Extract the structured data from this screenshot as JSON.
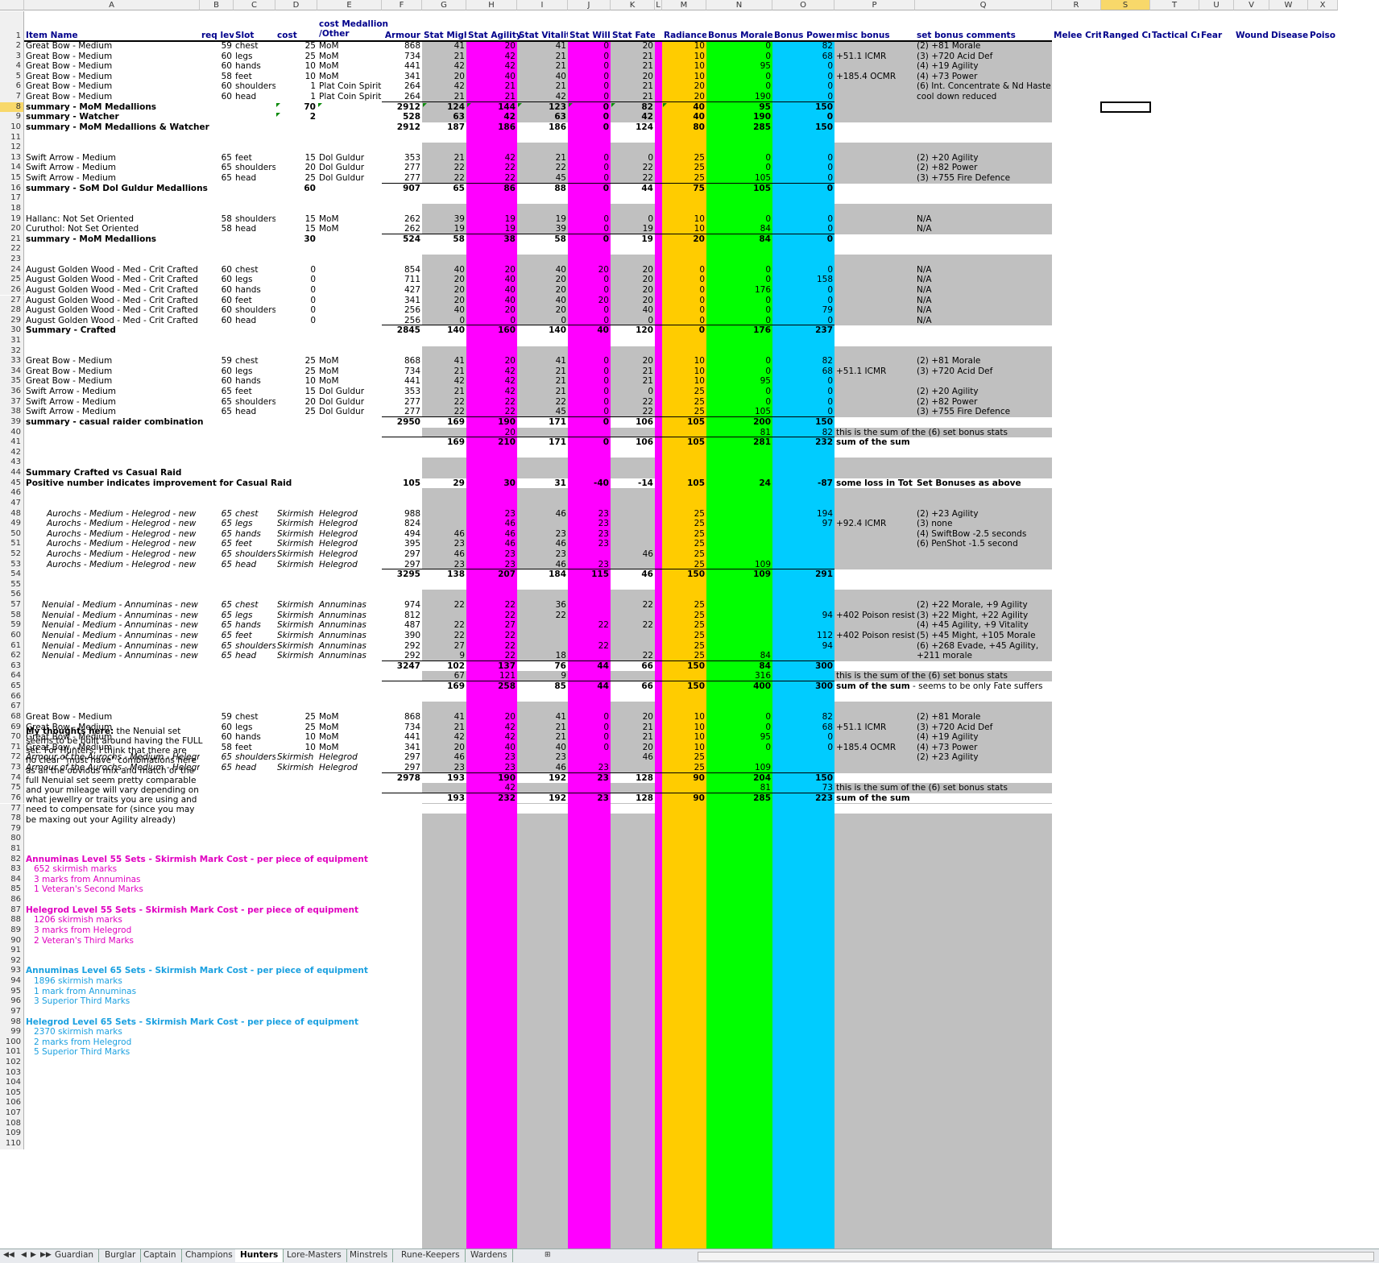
{
  "columns": [
    "A",
    "B",
    "C",
    "D",
    "E",
    "F",
    "G",
    "H",
    "I",
    "J",
    "K",
    "L",
    "M",
    "N",
    "O",
    "P",
    "Q",
    "R",
    "S",
    "T",
    "U",
    "V",
    "W",
    "X"
  ],
  "tabs": [
    "Guardian",
    "Burglar",
    "Captain",
    "Champions",
    "Hunters",
    "Lore-Masters",
    "Minstrels",
    "Rune-Keepers",
    "Wardens"
  ],
  "active_tab": "Hunters",
  "colors": {
    "grey": "#c0c0c0",
    "magenta": "#ff00ff",
    "orange": "#ffcc00",
    "green": "#00ff00",
    "cyan": "#00ccff",
    "header_text": "#00008b"
  },
  "header": {
    "A": "Item Name",
    "B": "req level",
    "C": "Slot",
    "D": "cost",
    "E1": "cost Medallion",
    "E2": "/Other",
    "F": "Armour",
    "G": "Stat Might",
    "H": "Stat Agility",
    "I": "Stat Vitality",
    "J": "Stat Will",
    "K": "Stat Fate",
    "M": "Radiance",
    "N": "Bonus Morale",
    "O": "Bonus Power",
    "P": "misc bonus",
    "Q": "set bonus comments",
    "R": "Melee Crit",
    "S": "Ranged Crit",
    "T": "Tactical Cri",
    "U": "Fear",
    "V": "Wound",
    "W": "Disease",
    "X": "Poiso"
  },
  "rows": {
    "2": {
      "A": "Great Bow - Medium",
      "B": "59",
      "C": "chest",
      "D": "25",
      "E": "MoM",
      "F": "868",
      "G": "41",
      "H": "20",
      "I": "41",
      "J": "0",
      "K": "20",
      "M": "10",
      "N": "0",
      "O": "82",
      "Q": "(2) +81 Morale"
    },
    "3": {
      "A": "Great Bow - Medium",
      "B": "60",
      "C": "legs",
      "D": "25",
      "E": "MoM",
      "F": "734",
      "G": "21",
      "H": "42",
      "I": "21",
      "J": "0",
      "K": "21",
      "M": "10",
      "N": "0",
      "O": "68",
      "P": "+51.1 ICMR",
      "Q": "(3) +720 Acid Def"
    },
    "4": {
      "A": "Great Bow - Medium",
      "B": "60",
      "C": "hands",
      "D": "10",
      "E": "MoM",
      "F": "441",
      "G": "42",
      "H": "42",
      "I": "21",
      "J": "0",
      "K": "21",
      "M": "10",
      "N": "95",
      "O": "0",
      "Q": "(4) +19 Agility"
    },
    "5": {
      "A": "Great Bow - Medium",
      "B": "58",
      "C": "feet",
      "D": "10",
      "E": "MoM",
      "F": "341",
      "G": "20",
      "H": "40",
      "I": "40",
      "J": "0",
      "K": "20",
      "M": "10",
      "N": "0",
      "O": "0",
      "P": "+185.4 OCMR",
      "Q": "(4) +73 Power"
    },
    "6": {
      "A": "Great Bow - Medium",
      "B": "60",
      "C": "shoulders",
      "D": "1",
      "E": "Plat Coin Spirit",
      "F": "264",
      "G": "42",
      "H": "21",
      "I": "21",
      "J": "0",
      "K": "21",
      "M": "20",
      "N": "0",
      "O": "0",
      "Q": "(6) Int. Concentrate & Nd Haste"
    },
    "7": {
      "A": "Great Bow - Medium",
      "B": "60",
      "C": "head",
      "D": "1",
      "E": "Plat Coin Spirit",
      "F": "264",
      "G": "21",
      "H": "21",
      "I": "42",
      "J": "0",
      "K": "21",
      "M": "20",
      "N": "190",
      "O": "0",
      "Q": "cool down reduced"
    },
    "8": {
      "A": "summary - MoM Medallions",
      "D": "70",
      "F": "2912",
      "G": "124",
      "H": "144",
      "I": "123",
      "J": "0",
      "K": "82",
      "M": "40",
      "N": "95",
      "O": "150"
    },
    "9": {
      "A": "summary - Watcher",
      "D": "2",
      "F": "528",
      "G": "63",
      "H": "42",
      "I": "63",
      "J": "0",
      "K": "42",
      "M": "40",
      "N": "190",
      "O": "0"
    },
    "10": {
      "A": "summary - MoM Medallions & Watcher",
      "F": "2912",
      "G": "187",
      "H": "186",
      "I": "186",
      "J": "0",
      "K": "124",
      "M": "80",
      "N": "285",
      "O": "150"
    },
    "13": {
      "A": "Swift Arrow - Medium",
      "B": "65",
      "C": "feet",
      "D": "15",
      "E": "Dol Guldur",
      "F": "353",
      "G": "21",
      "H": "42",
      "I": "21",
      "J": "0",
      "K": "0",
      "M": "25",
      "N": "0",
      "O": "0",
      "Q": "(2) +20 Agility"
    },
    "14": {
      "A": "Swift Arrow - Medium",
      "B": "65",
      "C": "shoulders",
      "D": "20",
      "E": "Dol Guldur",
      "F": "277",
      "G": "22",
      "H": "22",
      "I": "22",
      "J": "0",
      "K": "22",
      "M": "25",
      "N": "0",
      "O": "0",
      "Q": "(2) +82 Power"
    },
    "15": {
      "A": "Swift Arrow - Medium",
      "B": "65",
      "C": "head",
      "D": "25",
      "E": "Dol Guldur",
      "F": "277",
      "G": "22",
      "H": "22",
      "I": "45",
      "J": "0",
      "K": "22",
      "M": "25",
      "N": "105",
      "O": "0",
      "Q": "(3) +755 Fire Defence"
    },
    "16": {
      "A": "summary - SoM Dol Guldur Medallions",
      "D": "60",
      "F": "907",
      "G": "65",
      "H": "86",
      "I": "88",
      "J": "0",
      "K": "44",
      "M": "75",
      "N": "105",
      "O": "0"
    },
    "19": {
      "A": "Hallanc: Not Set Oriented",
      "B": "58",
      "C": "shoulders",
      "D": "15",
      "E": "MoM",
      "F": "262",
      "G": "39",
      "H": "19",
      "I": "19",
      "J": "0",
      "K": "0",
      "M": "10",
      "N": "0",
      "O": "0",
      "Q": "N/A"
    },
    "20": {
      "A": "Curuthol: Not Set Oriented",
      "B": "58",
      "C": "head",
      "D": "15",
      "E": "MoM",
      "F": "262",
      "G": "19",
      "H": "19",
      "I": "39",
      "J": "0",
      "K": "19",
      "M": "10",
      "N": "84",
      "O": "0",
      "Q": "N/A"
    },
    "21": {
      "A": "summary - MoM Medallions",
      "D": "30",
      "F": "524",
      "G": "58",
      "H": "38",
      "I": "58",
      "J": "0",
      "K": "19",
      "M": "20",
      "N": "84",
      "O": "0"
    },
    "24": {
      "A": "August Golden Wood - Med - Crit Crafted",
      "B": "60",
      "C": "chest",
      "D": "0",
      "F": "854",
      "G": "40",
      "H": "20",
      "I": "40",
      "J": "20",
      "K": "20",
      "M": "0",
      "N": "0",
      "O": "0",
      "Q": "N/A"
    },
    "25": {
      "A": "August Golden Wood - Med - Crit Crafted",
      "B": "60",
      "C": "legs",
      "D": "0",
      "F": "711",
      "G": "20",
      "H": "40",
      "I": "20",
      "J": "0",
      "K": "20",
      "M": "0",
      "N": "0",
      "O": "158",
      "Q": "N/A"
    },
    "26": {
      "A": "August Golden Wood - Med - Crit Crafted",
      "B": "60",
      "C": "hands",
      "D": "0",
      "F": "427",
      "G": "20",
      "H": "40",
      "I": "20",
      "J": "0",
      "K": "20",
      "M": "0",
      "N": "176",
      "O": "0",
      "Q": "N/A"
    },
    "27": {
      "A": "August Golden Wood - Med - Crit Crafted",
      "B": "60",
      "C": "feet",
      "D": "0",
      "F": "341",
      "G": "20",
      "H": "40",
      "I": "40",
      "J": "20",
      "K": "20",
      "M": "0",
      "N": "0",
      "O": "0",
      "Q": "N/A"
    },
    "28": {
      "A": "August Golden Wood - Med - Crit Crafted",
      "B": "60",
      "C": "shoulders",
      "D": "0",
      "F": "256",
      "G": "40",
      "H": "20",
      "I": "20",
      "J": "0",
      "K": "40",
      "M": "0",
      "N": "0",
      "O": "79",
      "Q": "N/A"
    },
    "29": {
      "A": "August Golden Wood - Med - Crit Crafted",
      "B": "60",
      "C": "head",
      "D": "0",
      "F": "256",
      "G": "0",
      "H": "0",
      "I": "0",
      "J": "0",
      "K": "0",
      "M": "0",
      "N": "0",
      "O": "0",
      "Q": "N/A"
    },
    "30": {
      "A": "Summary - Crafted",
      "F": "2845",
      "G": "140",
      "H": "160",
      "I": "140",
      "J": "40",
      "K": "120",
      "M": "0",
      "N": "176",
      "O": "237"
    },
    "33": {
      "A": "Great Bow - Medium",
      "B": "59",
      "C": "chest",
      "D": "25",
      "E": "MoM",
      "F": "868",
      "G": "41",
      "H": "20",
      "I": "41",
      "J": "0",
      "K": "20",
      "M": "10",
      "N": "0",
      "O": "82",
      "Q": "(2) +81 Morale"
    },
    "34": {
      "A": "Great Bow - Medium",
      "B": "60",
      "C": "legs",
      "D": "25",
      "E": "MoM",
      "F": "734",
      "G": "21",
      "H": "42",
      "I": "21",
      "J": "0",
      "K": "21",
      "M": "10",
      "N": "0",
      "O": "68",
      "P": "+51.1 ICMR",
      "Q": "(3) +720 Acid Def"
    },
    "35": {
      "A": "Great Bow - Medium",
      "B": "60",
      "C": "hands",
      "D": "10",
      "E": "MoM",
      "F": "441",
      "G": "42",
      "H": "42",
      "I": "21",
      "J": "0",
      "K": "21",
      "M": "10",
      "N": "95",
      "O": "0"
    },
    "36": {
      "A": "Swift Arrow - Medium",
      "B": "65",
      "C": "feet",
      "D": "15",
      "E": "Dol Guldur",
      "F": "353",
      "G": "21",
      "H": "42",
      "I": "21",
      "J": "0",
      "K": "0",
      "M": "25",
      "N": "0",
      "O": "0",
      "Q": "(2) +20 Agility"
    },
    "37": {
      "A": "Swift Arrow - Medium",
      "B": "65",
      "C": "shoulders",
      "D": "20",
      "E": "Dol Guldur",
      "F": "277",
      "G": "22",
      "H": "22",
      "I": "22",
      "J": "0",
      "K": "22",
      "M": "25",
      "N": "0",
      "O": "0",
      "Q": "(2) +82 Power"
    },
    "38": {
      "A": "Swift Arrow - Medium",
      "B": "65",
      "C": "head",
      "D": "25",
      "E": "Dol Guldur",
      "F": "277",
      "G": "22",
      "H": "22",
      "I": "45",
      "J": "0",
      "K": "22",
      "M": "25",
      "N": "105",
      "O": "0",
      "Q": "(3) +755 Fire Defence"
    },
    "39": {
      "A": "summary - casual raider combination",
      "F": "2950",
      "G": "169",
      "H": "190",
      "I": "171",
      "J": "0",
      "K": "106",
      "M": "105",
      "N": "200",
      "O": "150"
    },
    "40": {
      "H": "20",
      "N": "81",
      "O": "82",
      "P": "this is the sum of the (6) set bonus stats"
    },
    "41": {
      "G": "169",
      "H": "210",
      "I": "171",
      "J": "0",
      "K": "106",
      "M": "105",
      "N": "281",
      "O": "232",
      "P": "sum of the sum"
    },
    "44": {
      "A": "Summary Crafted vs Casual Raid"
    },
    "45": {
      "A": "Positive number indicates improvement for Casual Raid",
      "F": "105",
      "G": "29",
      "H": "30",
      "I": "31",
      "J": "-40",
      "K": "-14",
      "M": "105",
      "N": "24",
      "O": "-87",
      "P": "some loss in Tot",
      "Q": "Set Bonuses as above"
    },
    "48": {
      "A": "Aurochs - Medium - Helegrod - new",
      "B": "65",
      "C": "chest",
      "D": "Skirmish",
      "E": "Helegrod",
      "F": "988",
      "H": "23",
      "I": "46",
      "J": "23",
      "M": "25",
      "O": "194",
      "Q": "(2) +23 Agility"
    },
    "49": {
      "A": "Aurochs - Medium - Helegrod - new",
      "B": "65",
      "C": "legs",
      "D": "Skirmish",
      "E": "Helegrod",
      "F": "824",
      "H": "46",
      "J": "23",
      "M": "25",
      "O": "97",
      "P": "+92.4 ICMR",
      "Q": "(3) none"
    },
    "50": {
      "A": "Aurochs - Medium - Helegrod - new",
      "B": "65",
      "C": "hands",
      "D": "Skirmish",
      "E": "Helegrod",
      "F": "494",
      "G": "46",
      "H": "46",
      "I": "23",
      "J": "23",
      "M": "25",
      "Q": "(4) SwiftBow -2.5 seconds"
    },
    "51": {
      "A": "Aurochs - Medium - Helegrod - new",
      "B": "65",
      "C": "feet",
      "D": "Skirmish",
      "E": "Helegrod",
      "F": "395",
      "G": "23",
      "H": "46",
      "I": "46",
      "J": "23",
      "M": "25",
      "Q": "(6) PenShot -1.5 second"
    },
    "52": {
      "A": "Aurochs - Medium - Helegrod - new",
      "B": "65",
      "C": "shoulders",
      "D": "Skirmish",
      "E": "Helegrod",
      "F": "297",
      "G": "46",
      "H": "23",
      "I": "23",
      "K": "46",
      "M": "25"
    },
    "53": {
      "A": "Aurochs - Medium - Helegrod - new",
      "B": "65",
      "C": "head",
      "D": "Skirmish",
      "E": "Helegrod",
      "F": "297",
      "G": "23",
      "H": "23",
      "I": "46",
      "J": "23",
      "M": "25",
      "N": "109"
    },
    "54": {
      "F": "3295",
      "G": "138",
      "H": "207",
      "I": "184",
      "J": "115",
      "K": "46",
      "M": "150",
      "N": "109",
      "O": "291"
    },
    "57": {
      "A": "Nenuial - Medium - Annuminas - new",
      "B": "65",
      "C": "chest",
      "D": "Skirmish",
      "E": "Annuminas",
      "F": "974",
      "G": "22",
      "H": "22",
      "I": "36",
      "K": "22",
      "M": "25",
      "Q": "(2) +22 Morale, +9 Agility"
    },
    "58": {
      "A": "Nenuial - Medium - Annuminas - new",
      "B": "65",
      "C": "legs",
      "D": "Skirmish",
      "E": "Annuminas",
      "F": "812",
      "H": "22",
      "I": "22",
      "M": "25",
      "O": "94",
      "P": "+402 Poison resist",
      "Q": "(3) +22 Might, +22 Agility"
    },
    "59": {
      "A": "Nenuial - Medium - Annuminas - new",
      "B": "65",
      "C": "hands",
      "D": "Skirmish",
      "E": "Annuminas",
      "F": "487",
      "G": "22",
      "H": "27",
      "J": "22",
      "K": "22",
      "M": "25",
      "Q": "(4) +45 Agility, +9 Vitality"
    },
    "60": {
      "A": "Nenuial - Medium - Annuminas - new",
      "B": "65",
      "C": "feet",
      "D": "Skirmish",
      "E": "Annuminas",
      "F": "390",
      "G": "22",
      "H": "22",
      "M": "25",
      "O": "112",
      "P": "+402 Poison resist",
      "Q": "(5) +45 Might, +105 Morale"
    },
    "61": {
      "A": "Nenuial - Medium - Annuminas - new",
      "B": "65",
      "C": "shoulders",
      "D": "Skirmish",
      "E": "Annuminas",
      "F": "292",
      "G": "27",
      "H": "22",
      "J": "22",
      "M": "25",
      "O": "94",
      "Q": "(6) +268 Evade, +45 Agility,"
    },
    "62": {
      "A": "Nenuial - Medium - Annuminas - new",
      "B": "65",
      "C": "head",
      "D": "Skirmish",
      "E": "Annuminas",
      "F": "292",
      "G": "9",
      "H": "22",
      "I": "18",
      "K": "22",
      "M": "25",
      "N": "84",
      "Q": "+211 morale"
    },
    "63": {
      "F": "3247",
      "G": "102",
      "H": "137",
      "I": "76",
      "J": "44",
      "K": "66",
      "M": "150",
      "N": "84",
      "O": "300"
    },
    "64": {
      "G": "67",
      "H": "121",
      "I": "9",
      "N": "316",
      "P": "this is the sum of the (6) set bonus stats"
    },
    "65": {
      "G": "169",
      "H": "258",
      "I": "85",
      "J": "44",
      "K": "66",
      "M": "150",
      "N": "400",
      "O": "300",
      "P": "sum of the sum - seems to be only Fate suffers"
    },
    "68": {
      "A": "Great Bow - Medium",
      "B": "59",
      "C": "chest",
      "D": "25",
      "E": "MoM",
      "F": "868",
      "G": "41",
      "H": "20",
      "I": "41",
      "J": "0",
      "K": "20",
      "M": "10",
      "N": "0",
      "O": "82",
      "Q": "(2) +81 Morale"
    },
    "69": {
      "A": "Great Bow - Medium",
      "B": "60",
      "C": "legs",
      "D": "25",
      "E": "MoM",
      "F": "734",
      "G": "21",
      "H": "42",
      "I": "21",
      "J": "0",
      "K": "21",
      "M": "10",
      "N": "0",
      "O": "68",
      "P": "+51.1 ICMR",
      "Q": "(3) +720 Acid Def"
    },
    "70": {
      "A": "Great Bow - Medium",
      "B": "60",
      "C": "hands",
      "D": "10",
      "E": "MoM",
      "F": "441",
      "G": "42",
      "H": "42",
      "I": "21",
      "J": "0",
      "K": "21",
      "M": "10",
      "N": "95",
      "O": "0",
      "Q": "(4) +19 Agility"
    },
    "71": {
      "A": "Great Bow - Medium",
      "B": "58",
      "C": "feet",
      "D": "10",
      "E": "MoM",
      "F": "341",
      "G": "20",
      "H": "40",
      "I": "40",
      "J": "0",
      "K": "20",
      "M": "10",
      "N": "0",
      "O": "0",
      "P": "+185.4 OCMR",
      "Q": "(4) +73 Power"
    },
    "72": {
      "A": "Armour of the Aurochs - Medium - Helegrod",
      "B": "65",
      "C": "shoulders",
      "D": "Skirmish",
      "E": "Helegrod",
      "F": "297",
      "G": "46",
      "H": "23",
      "I": "23",
      "K": "46",
      "M": "25",
      "Q": "(2) +23 Agility"
    },
    "73": {
      "A": "Armour of the Aurochs - Medium - Helegrod",
      "B": "65",
      "C": "head",
      "D": "Skirmish",
      "E": "Helegrod",
      "F": "297",
      "G": "23",
      "H": "23",
      "I": "46",
      "J": "23",
      "M": "25",
      "N": "109"
    },
    "74": {
      "F": "2978",
      "G": "193",
      "H": "190",
      "I": "192",
      "J": "23",
      "K": "128",
      "M": "90",
      "N": "204",
      "O": "150"
    },
    "75": {
      "H": "42",
      "N": "81",
      "O": "73",
      "P": "this is the sum of the (6) set bonus stats"
    },
    "76": {
      "G": "193",
      "H": "232",
      "I": "192",
      "J": "23",
      "K": "128",
      "M": "90",
      "N": "285",
      "O": "223",
      "P": "sum of the sum"
    }
  },
  "thoughts": {
    "bold": "My thoughts here:",
    "lines": [
      "the Nenuial set",
      "seems to be built around having the FULL",
      "set.  For Hunters, I think that there are",
      "no clear \"must have\" combinations here",
      "as all the obvious mix and match or the",
      "full Nenuial set seem pretty comparable",
      "and your mileage will vary depending on",
      "what jewellry or traits you are using and",
      "need to compensate for (since you may",
      "be maxing out your Agility already)"
    ]
  },
  "costs": {
    "82": "Annuminas Level 55 Sets - Skirmish Mark Cost - per piece of equipment",
    "83": "652 skirmish marks",
    "84": "3 marks from Annuminas",
    "85": "1 Veteran's Second Marks",
    "87": "Helegrod Level 55 Sets - Skirmish Mark Cost - per piece of equipment",
    "88": "1206 skirmish marks",
    "89": "3 marks from Helegrod",
    "90": "2 Veteran's Third Marks",
    "93": "Annuminas Level 65 Sets - Skirmish Mark Cost - per piece of equipment",
    "94": "1896 skirmish marks",
    "95": "1 mark from Annuminas",
    "96": "3 Superior Third Marks",
    "98": "Helegrod Level 65 Sets - Skirmish Mark Cost - per piece of equipment",
    "99": "2370 skirmish marks",
    "100": "2 marks from Helegrod",
    "101": "5 Superior Third Marks"
  }
}
